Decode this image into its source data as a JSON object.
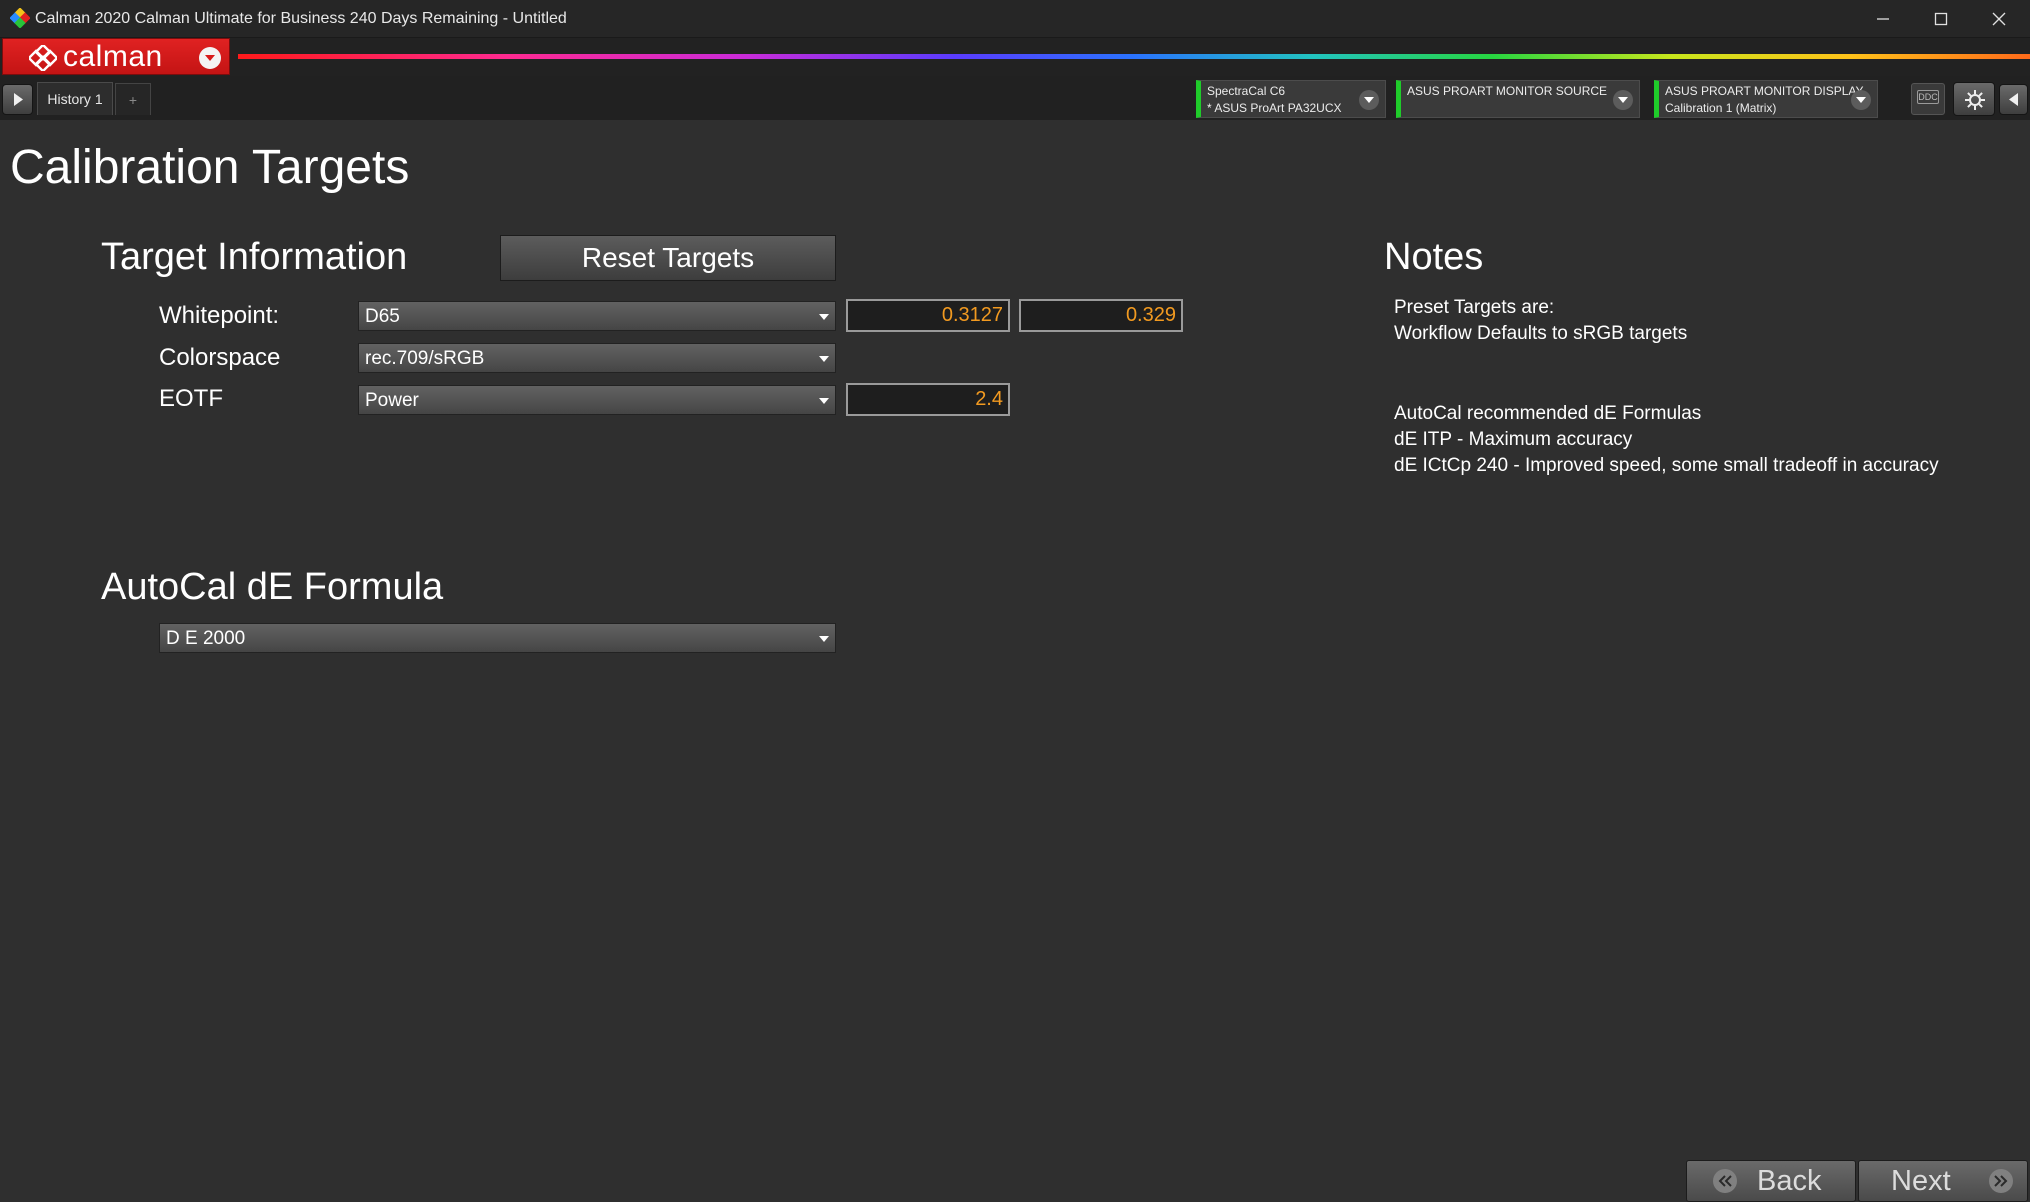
{
  "window": {
    "title": "Calman 2020 Calman Ultimate for Business 240 Days Remaining  -  Untitled",
    "controls": [
      "minimize-icon",
      "maximize-icon",
      "close-icon"
    ]
  },
  "brand": {
    "name": "calman",
    "color": "#d81a1a"
  },
  "tabs": [
    {
      "label": "History 1"
    }
  ],
  "tab_add_label": "+",
  "devices": [
    {
      "line1": "SpectraCal C6",
      "line2": "* ASUS ProArt PA32UCX",
      "status_color": "#1fcc2a"
    },
    {
      "line1": "ASUS PROART MONITOR SOURCE",
      "line2": "",
      "status_color": "#1fcc2a"
    },
    {
      "line1": "ASUS PROART MONITOR DISPLAY",
      "line2": "Calibration 1 (Matrix)",
      "status_color": "#1fcc2a"
    }
  ],
  "toolbar": {
    "ddc_label": "DDC"
  },
  "page": {
    "title": "Calibration Targets",
    "target_info": {
      "heading": "Target Information",
      "reset_label": "Reset Targets",
      "whitepoint": {
        "label": "Whitepoint:",
        "value": "D65",
        "x": "0.3127",
        "y": "0.329"
      },
      "colorspace": {
        "label": "Colorspace",
        "value": "rec.709/sRGB"
      },
      "eotf": {
        "label": "EOTF",
        "value": "Power",
        "gamma": "2.4"
      }
    },
    "autocal": {
      "heading": "AutoCal dE Formula",
      "value": "D E 2000"
    },
    "notes": {
      "heading": "Notes",
      "lines": [
        "Preset Targets are:",
        "Workflow Defaults to sRGB targets",
        "AutoCal recommended dE Formulas",
        "dE ITP - Maximum accuracy",
        "dE ICtCp 240 - Improved speed, some small tradeoff in accuracy"
      ]
    }
  },
  "footer": {
    "back_label": "Back",
    "next_label": "Next"
  },
  "colors": {
    "accent_value": "#f29a20",
    "background": "#2f2f2f"
  }
}
